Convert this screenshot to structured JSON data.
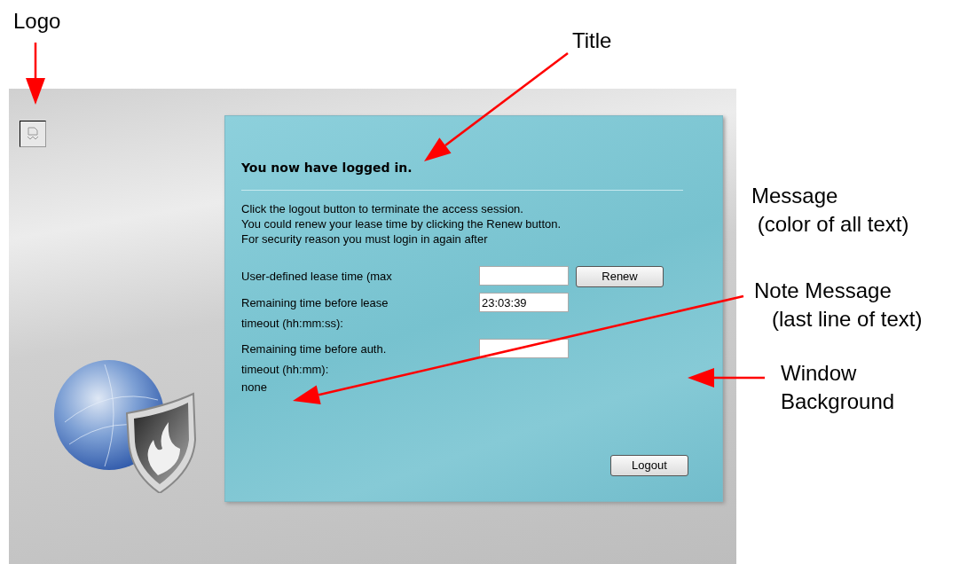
{
  "annotations": [
    {
      "kind": "logo",
      "lines": [
        "Logo"
      ]
    },
    {
      "kind": "title",
      "lines": [
        "Title"
      ]
    },
    {
      "kind": "message",
      "lines": [
        "Message",
        " (color of all text)"
      ]
    },
    {
      "kind": "note",
      "lines": [
        "Note Message",
        "   (last line of text)"
      ]
    },
    {
      "kind": "background",
      "lines": [
        "Window",
        "Background"
      ]
    }
  ],
  "panel": {
    "title": "You now have logged in.",
    "message": [
      "Click the logout button to terminate the access session.",
      "You could renew your lease time by clicking the Renew button.",
      "For security reason you must login in again after"
    ],
    "fields": [
      {
        "label": "User-defined lease time (max",
        "button": "Renew"
      },
      {
        "label": "Remaining time before lease timeout (hh:mm:ss):",
        "value": "23:03:39"
      },
      {
        "label": "Remaining time before auth. timeout (hh:mm):"
      }
    ],
    "note": "none",
    "logout_button": "Logout"
  }
}
